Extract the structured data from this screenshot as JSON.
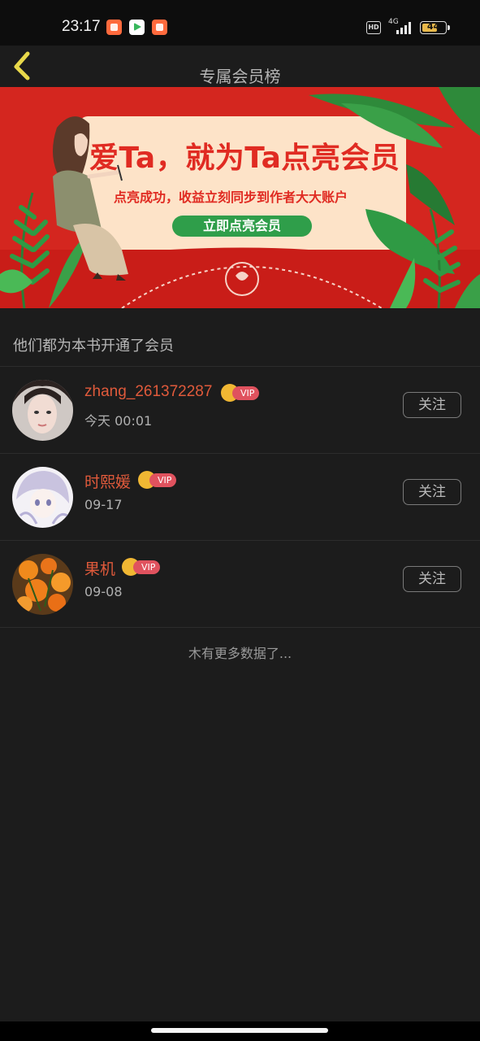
{
  "status_bar": {
    "time": "23:17",
    "hd": "HD",
    "network": "4G",
    "battery": "44"
  },
  "header": {
    "title": "专属会员榜"
  },
  "banner": {
    "title": "爱Ta，就为Ta点亮会员",
    "subtitle": "点亮成功，收益立刻同步到作者大大账户",
    "button": "立即点亮会员"
  },
  "section": {
    "title": "他们都为本书开通了会员"
  },
  "members": [
    {
      "name": "zhang_261372287",
      "badge": "VIP",
      "time": "今天 00:01",
      "follow": "关注"
    },
    {
      "name": "时熙媛",
      "badge": "VIP",
      "time": "09-17",
      "follow": "关注"
    },
    {
      "name": "果机",
      "badge": "VIP",
      "time": "09-08",
      "follow": "关注"
    }
  ],
  "footer": {
    "no_more": "木有更多数据了..."
  },
  "colors": {
    "accent_name": "#e05a3b",
    "vip_tag": "#e0525e",
    "banner_red": "#d4261f",
    "banner_button": "#2f9e4a"
  }
}
